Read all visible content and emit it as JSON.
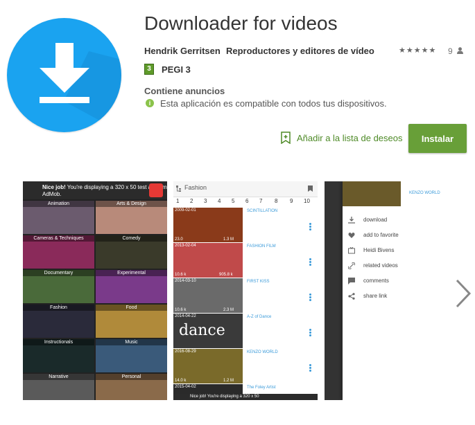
{
  "app": {
    "title": "Downloader for videos",
    "developer": "Hendrik Gerritsen",
    "category": "Reproductores y editores de vídeo",
    "stars": "★★★★★",
    "rating_count": "9",
    "pegi_badge": "3",
    "pegi": "PEGI 3",
    "ads": "Contiene anuncios",
    "compatibility": "Esta aplicación es compatible con todos tus dispositivos.",
    "info_glyph": "i",
    "wishlist_label": "Añadir a la lista de deseos",
    "install_label": "Instalar",
    "icon_color": "#1aa3f0",
    "accent": "#689f38"
  },
  "screenshot1": {
    "ad_text_bold": "Nice job!",
    "ad_text": " You're displaying a 320 x 50 test ad from AdMob.",
    "tiles": [
      {
        "label": "Animation",
        "color": "#6b5b6e"
      },
      {
        "label": "Arts & Design",
        "color": "#b88a7a"
      },
      {
        "label": "Cameras & Techniques",
        "color": "#8a2a5a"
      },
      {
        "label": "Comedy",
        "color": "#3a3a2a"
      },
      {
        "label": "Documentary",
        "color": "#4a6a3a"
      },
      {
        "label": "Experimental",
        "color": "#7a3a8a"
      },
      {
        "label": "Fashion",
        "color": "#2a2a3a"
      },
      {
        "label": "Food",
        "color": "#b08a3a"
      },
      {
        "label": "Instructionals",
        "color": "#1a2a2a"
      },
      {
        "label": "Music",
        "color": "#3a5a7a"
      },
      {
        "label": "Narrative",
        "color": "#5a5a5a"
      },
      {
        "label": "Personal",
        "color": "#8a6a4a"
      }
    ]
  },
  "screenshot2": {
    "title": "Fashion",
    "pages": [
      "1",
      "2",
      "3",
      "4",
      "5",
      "6",
      "7",
      "8",
      "9",
      "10"
    ],
    "rows": [
      {
        "title": "SCINTILLATION",
        "date": "2009-02-01",
        "likes": "23.0",
        "views": "1.3 M",
        "color": "#8a3a1a"
      },
      {
        "title": "FASHION FILM",
        "date": "2013-02-04",
        "likes": "10.6 k",
        "views": "905.8 k",
        "color": "#c04a4a"
      },
      {
        "title": "FIRST KISS",
        "date": "2014-03-10",
        "likes": "10.6 k",
        "views": "2.3 M",
        "color": "#6a6a6a"
      },
      {
        "title": "A-Z of Dance",
        "date": "2014-04-22",
        "likes": "",
        "views": "",
        "color": "#3a3a3a"
      },
      {
        "title": "KENZO WORLD",
        "date": "2016-08-29",
        "likes": "14.0 k",
        "views": "1.2 M",
        "color": "#7a6a2a"
      },
      {
        "title": "The Foley Artist",
        "date": "2015-04-02",
        "likes": "",
        "views": "",
        "color": "#2a2a2a"
      }
    ],
    "dance_overlay": "dance",
    "bottom_ad": "Nice job! You're displaying a 320 x 50"
  },
  "screenshot3": {
    "header": "KENZO WORLD",
    "menu": [
      "download",
      "add to favorite",
      "Heidi Bivens",
      "related videos",
      "comments",
      "share link"
    ]
  }
}
